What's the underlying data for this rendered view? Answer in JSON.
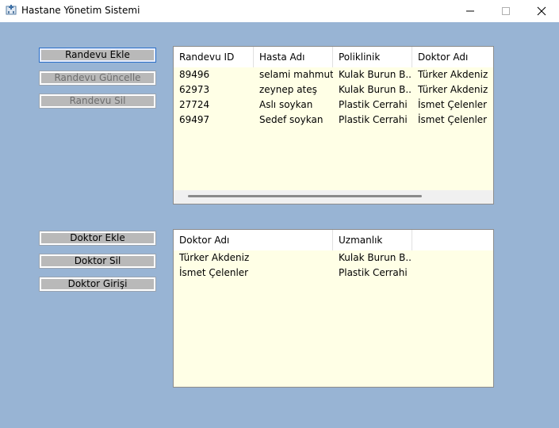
{
  "window": {
    "title": "Hastane Yönetim Sistemi",
    "minimize_icon": "minimize-icon",
    "maximize_icon": "maximize-icon",
    "close_icon": "close-icon"
  },
  "appointment_buttons": {
    "add": "Randevu Ekle",
    "update": "Randevu Güncelle",
    "delete": "Randevu Sil"
  },
  "doctor_buttons": {
    "add": "Doktor Ekle",
    "delete": "Doktor Sil",
    "login": "Doktor Girişi"
  },
  "appointments_table": {
    "columns": [
      "Randevu ID",
      "Hasta Adı",
      "Poliklinik",
      "Doktor Adı"
    ],
    "rows": [
      [
        "89496",
        "selami mahmut",
        "Kulak Burun B...",
        "Türker Akdeniz"
      ],
      [
        "62973",
        "zeynep ateş",
        "Kulak Burun B...",
        "Türker Akdeniz"
      ],
      [
        "27724",
        "Aslı soykan",
        "Plastik Cerrahi",
        "İsmet Çelenler"
      ],
      [
        "69497",
        "Sedef soykan",
        "Plastik Cerrahi",
        "İsmet Çelenler"
      ]
    ]
  },
  "doctors_table": {
    "columns": [
      "Doktor Adı",
      "Uzmanlık",
      ""
    ],
    "rows": [
      [
        "Türker Akdeniz",
        "Kulak Burun B..."
      ],
      [
        "İsmet Çelenler",
        "Plastik Cerrahi"
      ]
    ]
  },
  "colors": {
    "background": "#98b4d4",
    "table_background": "#ffffe6",
    "button_background": "#b9b9b9",
    "focus_border": "#2c6fc8"
  }
}
